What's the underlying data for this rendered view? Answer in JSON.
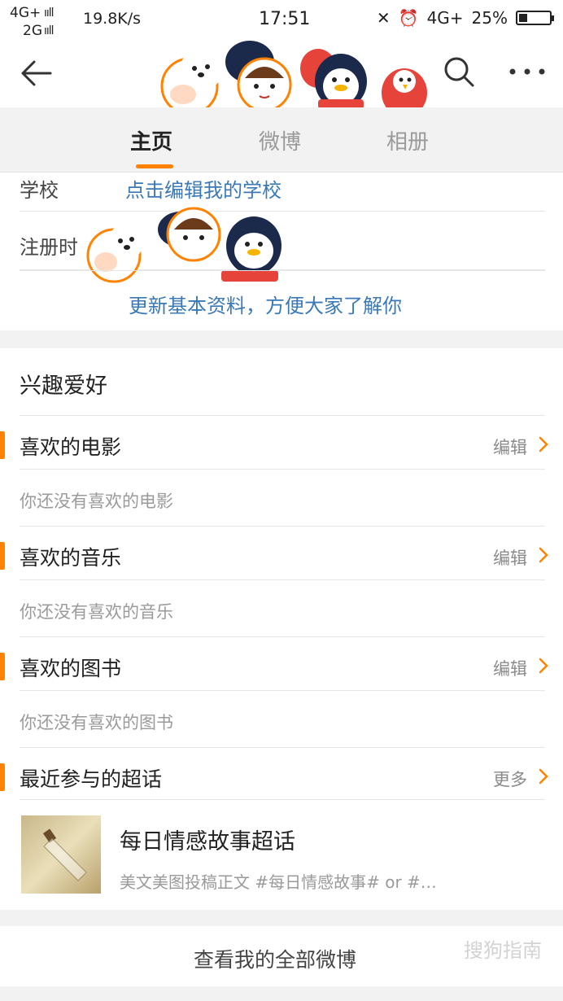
{
  "status_bar": {
    "network_top": "4G+",
    "network_bottom": "2G",
    "speed": "19.8K/s",
    "time": "17:51",
    "network_right": "4G+",
    "battery": "25%"
  },
  "tabs": [
    {
      "label": "主页",
      "active": true
    },
    {
      "label": "微博",
      "active": false
    },
    {
      "label": "相册",
      "active": false
    }
  ],
  "basic_info": {
    "rows": [
      {
        "label": "学校",
        "value": "点击编辑我的学校"
      },
      {
        "label": "注册时",
        "value": ""
      }
    ],
    "update_link": "更新基本资料，方便大家了解你"
  },
  "interests": {
    "title": "兴趣爱好",
    "sections": [
      {
        "title": "喜欢的电影",
        "action": "编辑",
        "empty": "你还没有喜欢的电影"
      },
      {
        "title": "喜欢的音乐",
        "action": "编辑",
        "empty": "你还没有喜欢的音乐"
      },
      {
        "title": "喜欢的图书",
        "action": "编辑",
        "empty": "你还没有喜欢的图书"
      },
      {
        "title": "最近参与的超话",
        "action": "更多"
      }
    ],
    "topic": {
      "title": "每日情感故事超话",
      "desc": "美文美图投稿正文 #每日情感故事# or #…"
    }
  },
  "view_all": "查看我的全部微博",
  "watermark": "搜狗指南",
  "colors": {
    "accent": "#ff8200",
    "link": "#3a79b6"
  }
}
